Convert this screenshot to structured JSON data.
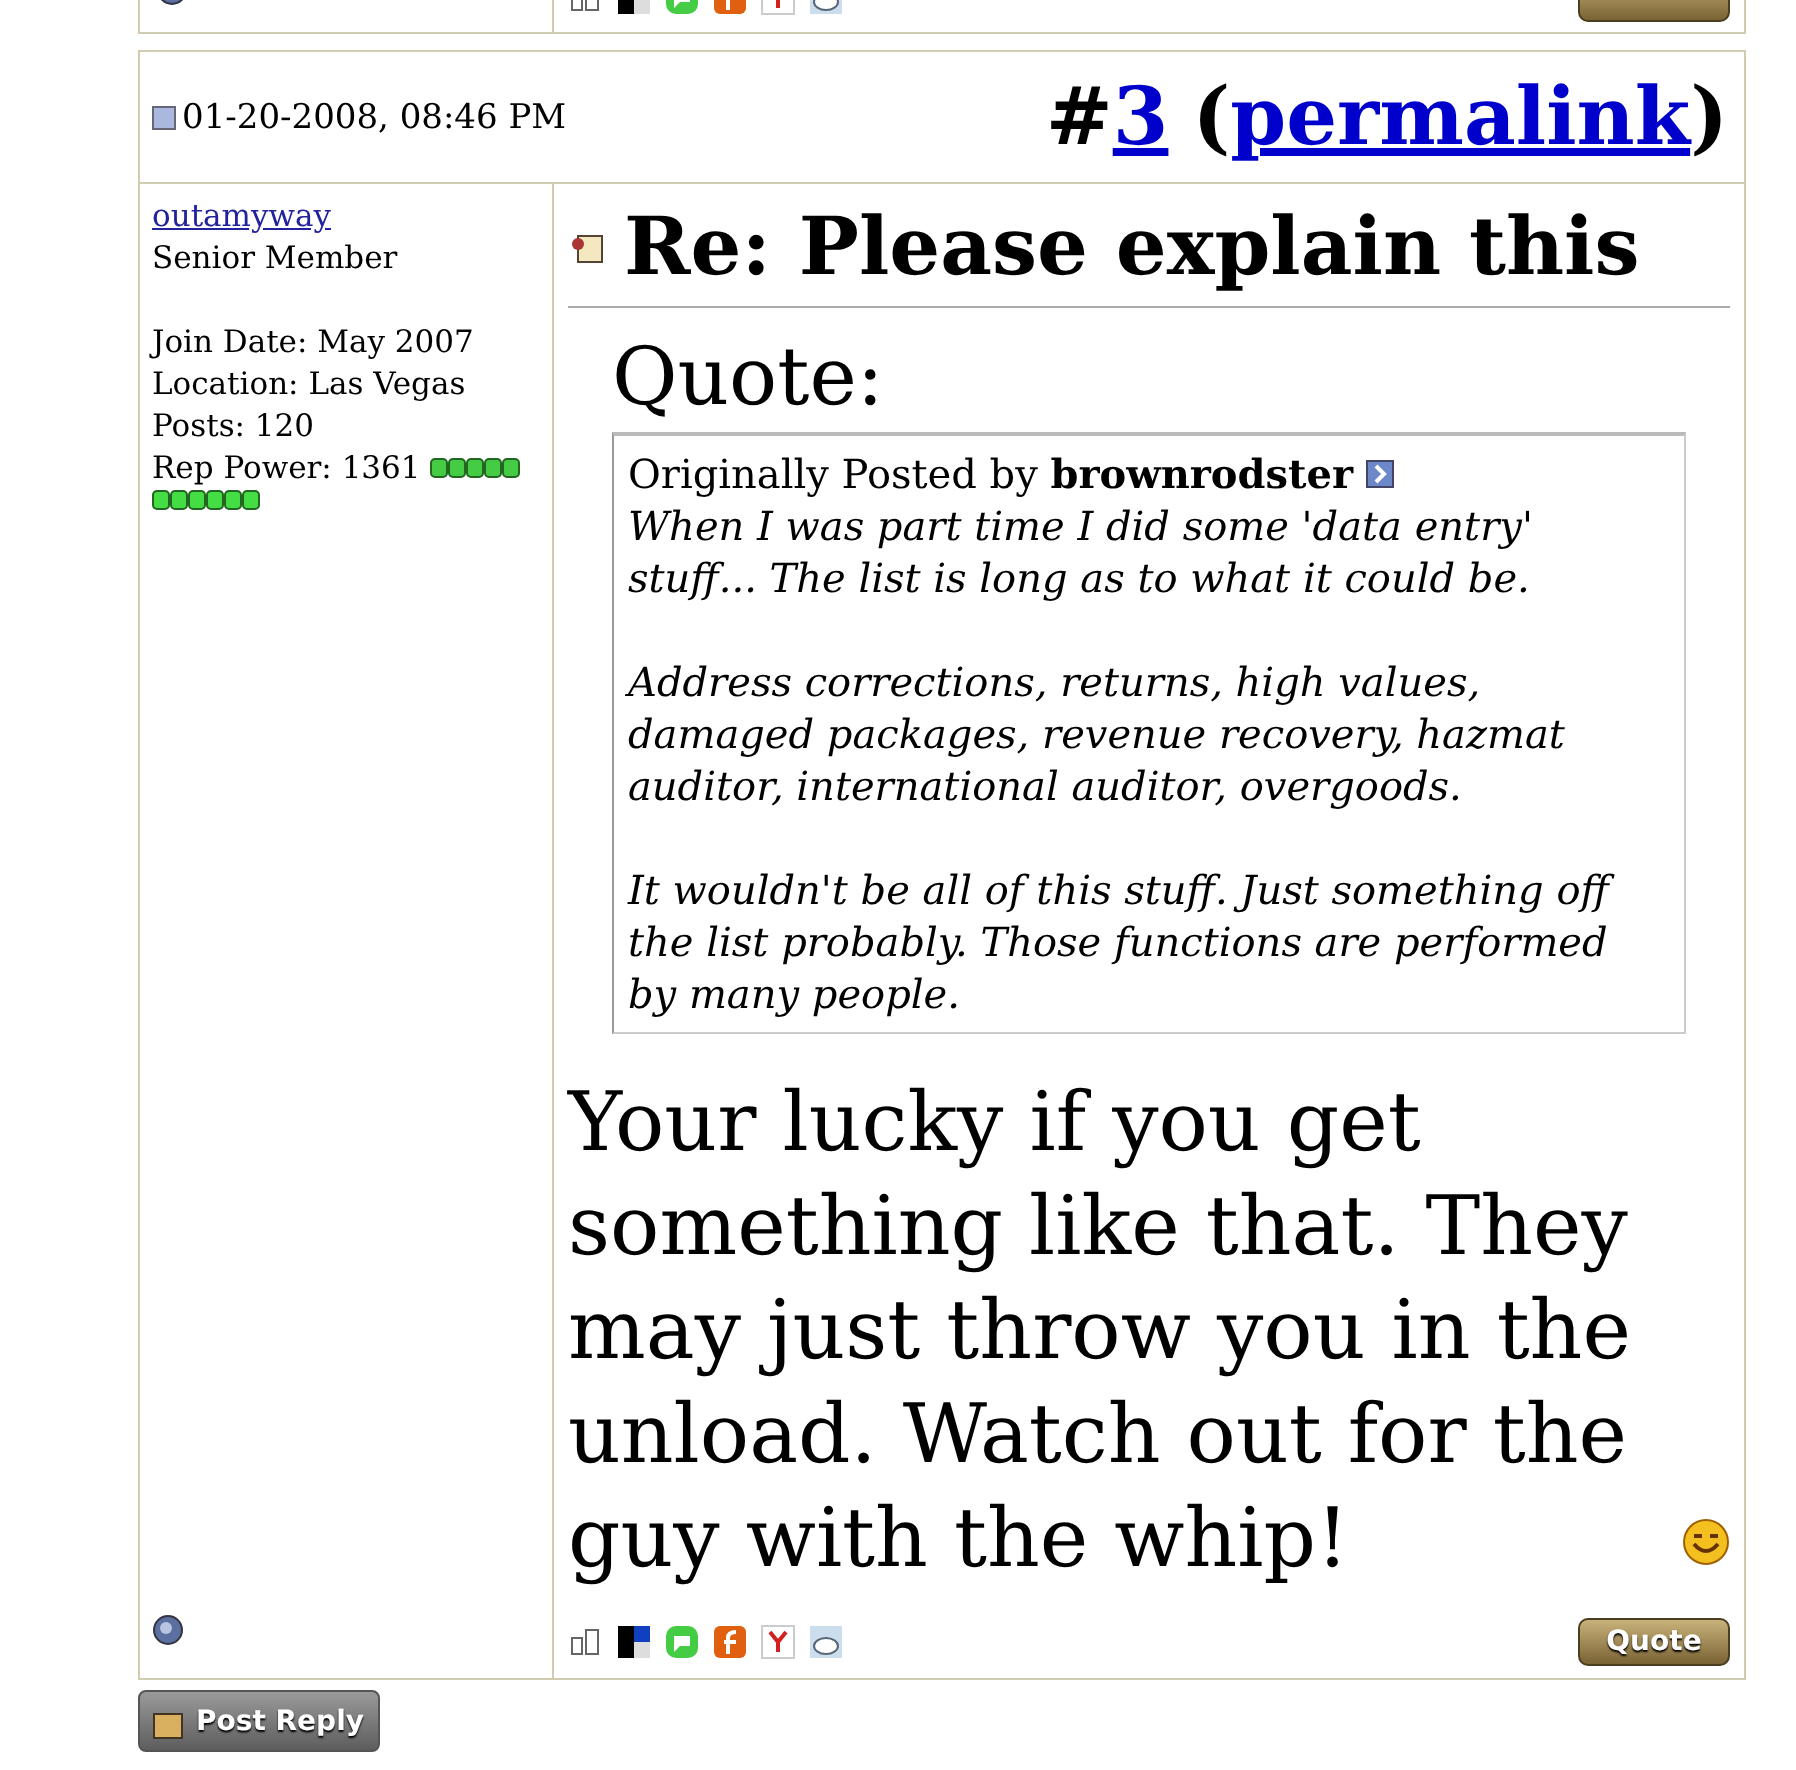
{
  "previous_post": {
    "online": false
  },
  "post": {
    "date": "01-20-2008, 08:46 PM",
    "number_prefix": "#",
    "number": "3",
    "permalink_open": "(",
    "permalink": "permalink",
    "permalink_close": ")",
    "user": {
      "name": "outamyway",
      "title": "Senior Member",
      "details": [
        "Join Date: May 2007",
        "Location: Las Vegas",
        "Posts: 120"
      ],
      "rep_label": "Rep Power: 1361",
      "online": false
    },
    "title": "Re: Please explain this",
    "quote": {
      "heading": "Quote:",
      "byline": "Originally Posted by",
      "author": "brownrodster",
      "paragraphs": [
        "When I was part time I did some 'data entry' stuff... The list is long as to what it could be.",
        "Address corrections, returns, high values, damaged packages, revenue recovery, hazmat auditor, international auditor, overgoods.",
        "It wouldn't be all of this stuff. Just something off the list probably. Those functions are performed by many people."
      ]
    },
    "message": "Your lucky if you get something like that. They may just throw you in the unload. Watch out for the guy with the whip!",
    "quote_button": "Quote"
  },
  "post_reply_button": "Post Reply"
}
